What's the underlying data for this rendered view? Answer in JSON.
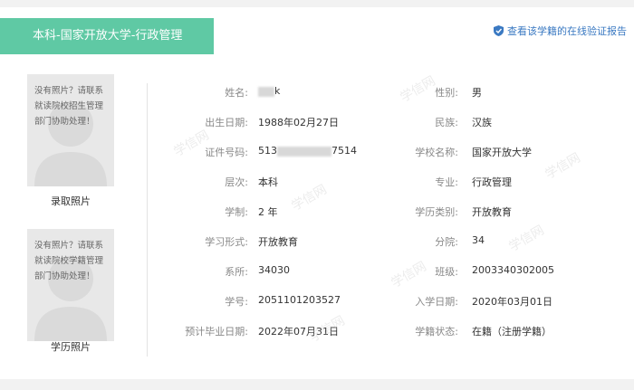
{
  "header": {
    "title": "本科-国家开放大学-行政管理",
    "verify_link": "查看该学籍的在线验证报告"
  },
  "photos": [
    {
      "message": "没有照片？请联系就读院校招生管理部门协助处理！",
      "label": "录取照片"
    },
    {
      "message": "没有照片？请联系就读院校学籍管理部门协助处理！",
      "label": "学历照片"
    }
  ],
  "fields_left": [
    {
      "label": "姓名:",
      "value_suffix": "k"
    },
    {
      "label": "出生日期:",
      "value": "1988年02月27日"
    },
    {
      "label": "证件号码:",
      "value_prefix": "513",
      "value_suffix": "7514"
    },
    {
      "label": "层次:",
      "value": "本科"
    },
    {
      "label": "学制:",
      "value": "2 年"
    },
    {
      "label": "学习形式:",
      "value": "开放教育"
    },
    {
      "label": "系所:",
      "value": "34030"
    },
    {
      "label": "学号:",
      "value": "2051101203527"
    },
    {
      "label": "预计毕业日期:",
      "value": "2022年07月31日"
    }
  ],
  "fields_right": [
    {
      "label": "性别:",
      "value": "男"
    },
    {
      "label": "民族:",
      "value": "汉族"
    },
    {
      "label": "学校名称:",
      "value": "国家开放大学"
    },
    {
      "label": "专业:",
      "value": "行政管理"
    },
    {
      "label": "学历类别:",
      "value": "开放教育"
    },
    {
      "label": "分院:",
      "value": "34"
    },
    {
      "label": "班级:",
      "value": "2003340302005"
    },
    {
      "label": "入学日期:",
      "value": "2020年03月01日"
    },
    {
      "label": "学籍状态:",
      "value": "在籍（注册学籍）"
    }
  ],
  "watermark": "学信网",
  "colors": {
    "header_bg": "#5fc9a4",
    "link": "#3a79c2"
  }
}
